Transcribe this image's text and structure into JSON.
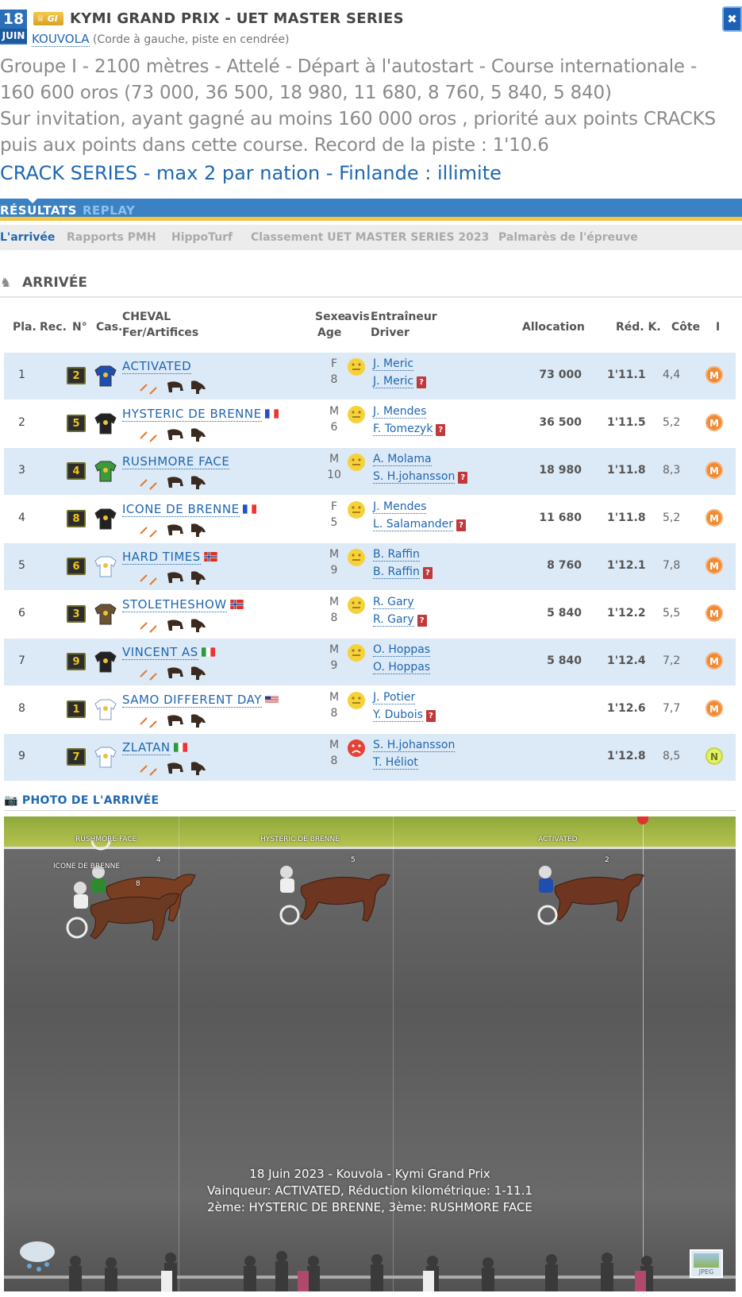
{
  "header": {
    "date_day": "18",
    "date_month": "JUIN",
    "badge": "GI",
    "title": "KYMI GRAND PRIX - UET MASTER SERIES",
    "venue": "KOUVOLA",
    "venue_detail": "(Corde à gauche, piste en cendrée)",
    "conditions": [
      "Groupe I - 2100 mètres - Attelé - Départ à l'autostart - Course internationale -",
      "160 600 oros (73 000, 36 500, 18 980, 11 680, 8 760, 5 840, 5 840)",
      "Sur invitation, ayant gagné au moins 160 000 oros , priorité aux points CRACKS",
      "puis aux points dans cette course. Record de la piste : 1'10.6"
    ],
    "crack_series": "CRACK SERIES - max 2 par nation - Finlande : illimite"
  },
  "tabs": {
    "results": "RÉSULTATS",
    "replay": "REPLAY"
  },
  "subtabs": [
    "L'arrivée",
    "Rapports PMH",
    "HippoTurf",
    "Classement UET MASTER SERIES 2023",
    "Palmarès de l'épreuve"
  ],
  "section_title": "ARRIVÉE",
  "columns": {
    "pla": "Pla.",
    "rec": "Rec.",
    "num": "N°",
    "cas": "Cas.",
    "cheval": "CHEVAL",
    "fer": "Fer/Artifices",
    "sexe": "Sexe",
    "age": "Age",
    "avis": "avis",
    "entraineur": "Entraîneur",
    "driver": "Driver",
    "allocation": "Allocation",
    "red": "Réd. K.",
    "cote": "Côte",
    "i": "I"
  },
  "rows": [
    {
      "pla": "1",
      "num": "2",
      "horse": "ACTIVATED",
      "flag": "",
      "sexe": "F",
      "age": "8",
      "avis": "neutral",
      "trainer": "J. Meric",
      "driver": "J. Meric",
      "driver_q": true,
      "alloc": "73 000",
      "red": "1'11.1",
      "cote": "4,4",
      "indic": "M",
      "silk": "#1f4fae"
    },
    {
      "pla": "2",
      "num": "5",
      "horse": "HYSTERIC DE BRENNE",
      "flag": "fr",
      "sexe": "M",
      "age": "6",
      "avis": "neutral",
      "trainer": "J. Mendes",
      "driver": "F. Tomezyk",
      "driver_q": true,
      "alloc": "36 500",
      "red": "1'11.5",
      "cote": "5,2",
      "indic": "M",
      "silk": "#222"
    },
    {
      "pla": "3",
      "num": "4",
      "horse": "RUSHMORE FACE",
      "flag": "",
      "sexe": "M",
      "age": "10",
      "avis": "neutral",
      "trainer": "A. Molama",
      "driver": "S. H.johansson",
      "driver_q": true,
      "alloc": "18 980",
      "red": "1'11.8",
      "cote": "8,3",
      "indic": "M",
      "silk": "#3d9a3a"
    },
    {
      "pla": "4",
      "num": "8",
      "horse": "ICONE DE BRENNE",
      "flag": "fr",
      "sexe": "F",
      "age": "5",
      "avis": "neutral",
      "trainer": "J. Mendes",
      "driver": "L. Salamander",
      "driver_q": true,
      "alloc": "11 680",
      "red": "1'11.8",
      "cote": "5,2",
      "indic": "M",
      "silk": "#222"
    },
    {
      "pla": "5",
      "num": "6",
      "horse": "HARD TIMES",
      "flag": "no",
      "sexe": "M",
      "age": "9",
      "avis": "neutral",
      "trainer": "B. Raffin",
      "driver": "B. Raffin",
      "driver_q": true,
      "alloc": "8 760",
      "red": "1'12.1",
      "cote": "7,8",
      "indic": "M",
      "silk": "#ffffff"
    },
    {
      "pla": "6",
      "num": "3",
      "horse": "STOLETHESHOW",
      "flag": "no",
      "sexe": "M",
      "age": "8",
      "avis": "neutral",
      "trainer": "R. Gary",
      "driver": "R. Gary",
      "driver_q": true,
      "alloc": "5 840",
      "red": "1'12.2",
      "cote": "5,5",
      "indic": "M",
      "silk": "#6b5332"
    },
    {
      "pla": "7",
      "num": "9",
      "horse": "VINCENT AS",
      "flag": "it",
      "sexe": "M",
      "age": "9",
      "avis": "neutral",
      "trainer": "O. Hoppas",
      "driver": "O. Hoppas",
      "driver_q": false,
      "alloc": "5 840",
      "red": "1'12.4",
      "cote": "7,2",
      "indic": "M",
      "silk": "#222"
    },
    {
      "pla": "8",
      "num": "1",
      "horse": "SAMO DIFFERENT DAY",
      "flag": "us",
      "sexe": "M",
      "age": "8",
      "avis": "neutral",
      "trainer": "J. Potier",
      "driver": "Y. Dubois",
      "driver_q": true,
      "alloc": "",
      "red": "1'12.6",
      "cote": "7,7",
      "indic": "M",
      "silk": "#ffffff"
    },
    {
      "pla": "9",
      "num": "7",
      "horse": "ZLATAN",
      "flag": "it",
      "sexe": "M",
      "age": "8",
      "avis": "sad",
      "trainer": "S. H.johansson",
      "driver": "T. Héliot",
      "driver_q": false,
      "alloc": "",
      "red": "1'12.8",
      "cote": "8,5",
      "indic": "N",
      "silk": "#ffffff"
    }
  ],
  "photo": {
    "title": "PHOTO DE L'ARRIVÉE",
    "labels": [
      "RUSHMORE FACE",
      "ICONE DE BRENNE",
      "HYSTERIC DE BRENNE",
      "ACTIVATED"
    ],
    "numbers": [
      "4",
      "8",
      "5",
      "2"
    ],
    "caption": [
      "18 Juin 2023 - Kouvola - Kymi Grand Prix",
      "Vainqueur: ACTIVATED, Réduction kilométrique: 1-11.1",
      "2ème: HYSTERIC DE BRENNE, 3ème: RUSHMORE FACE"
    ],
    "jpeg_label": "JPEG"
  },
  "colors": {
    "accent": "#1f67b1",
    "tabbar": "#3b82c4",
    "tab_underline": "#f4c542",
    "row_alt": "#dce9f6",
    "indic_m": "#ef8a32"
  }
}
